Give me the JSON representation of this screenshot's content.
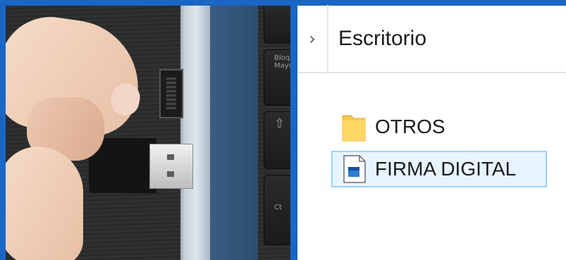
{
  "photo": {
    "keys": [
      {
        "label": "Bloq",
        "sub": "Mayús"
      },
      {
        "label": "⇧",
        "sub": ""
      },
      {
        "label": "Ct",
        "sub": ""
      }
    ]
  },
  "explorer": {
    "breadcrumb_icon": "chevron-right-icon",
    "breadcrumb": "Escritorio",
    "items": [
      {
        "name": "OTROS",
        "icon": "folder-icon",
        "selected": false
      },
      {
        "name": "FIRMA DIGITAL",
        "icon": "certificate-file-icon",
        "selected": true
      }
    ]
  },
  "colors": {
    "frame": "#1a66c4",
    "selection_bg": "#e8f4ff",
    "selection_border": "#99d1ff",
    "folder": "#f8c645"
  }
}
